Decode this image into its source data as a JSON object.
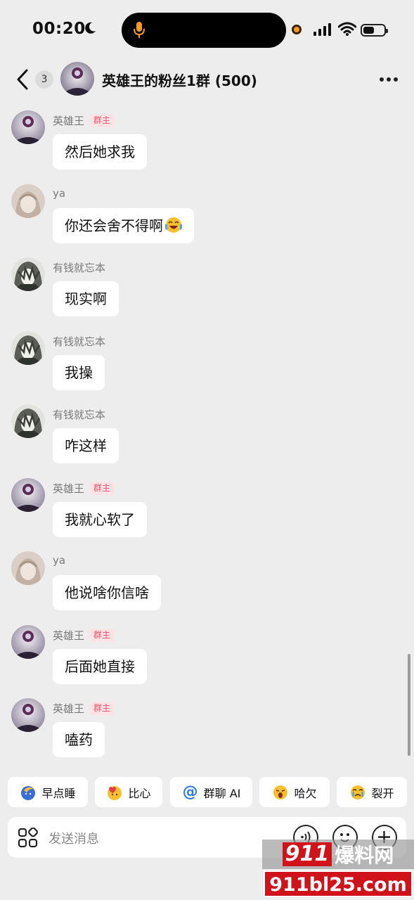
{
  "status_bar": {
    "time": "00:20",
    "icons": [
      "moon-icon",
      "mic-icon",
      "recording-dot-icon",
      "signal-icon",
      "wifi-icon",
      "battery-icon"
    ],
    "battery_level": 0.55
  },
  "header": {
    "back_icon": "chevron-left-icon",
    "unread_count": "3",
    "title": "英雄王的粉丝1群 (500)",
    "more_icon": "more-horizontal-icon"
  },
  "colors": {
    "background": "#ededed",
    "bubble": "#ffffff",
    "owner_tag_text": "#e8546b",
    "owner_tag_bg": "#fde3e6"
  },
  "messages": [
    {
      "sender": "英雄王",
      "tag": "群主",
      "avatar": "purple-eye",
      "text": "然后她求我",
      "emoji": ""
    },
    {
      "sender": "ya",
      "tag": "",
      "avatar": "pale-girl",
      "text": "你还会舍不得啊",
      "emoji": "crying-laughing"
    },
    {
      "sender": "有钱就忘本",
      "tag": "",
      "avatar": "anime-boy",
      "text": "现实啊",
      "emoji": ""
    },
    {
      "sender": "有钱就忘本",
      "tag": "",
      "avatar": "anime-boy",
      "text": "我操",
      "emoji": ""
    },
    {
      "sender": "有钱就忘本",
      "tag": "",
      "avatar": "anime-boy",
      "text": "咋这样",
      "emoji": ""
    },
    {
      "sender": "英雄王",
      "tag": "群主",
      "avatar": "purple-eye",
      "text": "我就心软了",
      "emoji": ""
    },
    {
      "sender": "ya",
      "tag": "",
      "avatar": "pale-girl",
      "text": "他说啥你信啥",
      "emoji": ""
    },
    {
      "sender": "英雄王",
      "tag": "群主",
      "avatar": "purple-eye",
      "text": "后面她直接",
      "emoji": ""
    },
    {
      "sender": "英雄王",
      "tag": "群主",
      "avatar": "purple-eye",
      "text": "嗑药",
      "emoji": ""
    }
  ],
  "quick_replies": [
    {
      "icon": "sleeping-moon-icon",
      "label": "早点睡"
    },
    {
      "icon": "heart-hands-icon",
      "label": "比心"
    },
    {
      "icon": "at-icon",
      "label": "群聊 AI"
    },
    {
      "icon": "yawn-icon",
      "label": "哈欠"
    },
    {
      "icon": "crying-face-icon",
      "label": "裂开"
    }
  ],
  "input": {
    "placeholder": "发送消息",
    "left_icon": "apps-grid-icon",
    "right_icons": [
      "voice-icon",
      "emoji-icon",
      "plus-icon"
    ]
  },
  "watermark": {
    "line1_digits": "911",
    "line1_text": "爆料网",
    "line2": "911bl25.com"
  }
}
